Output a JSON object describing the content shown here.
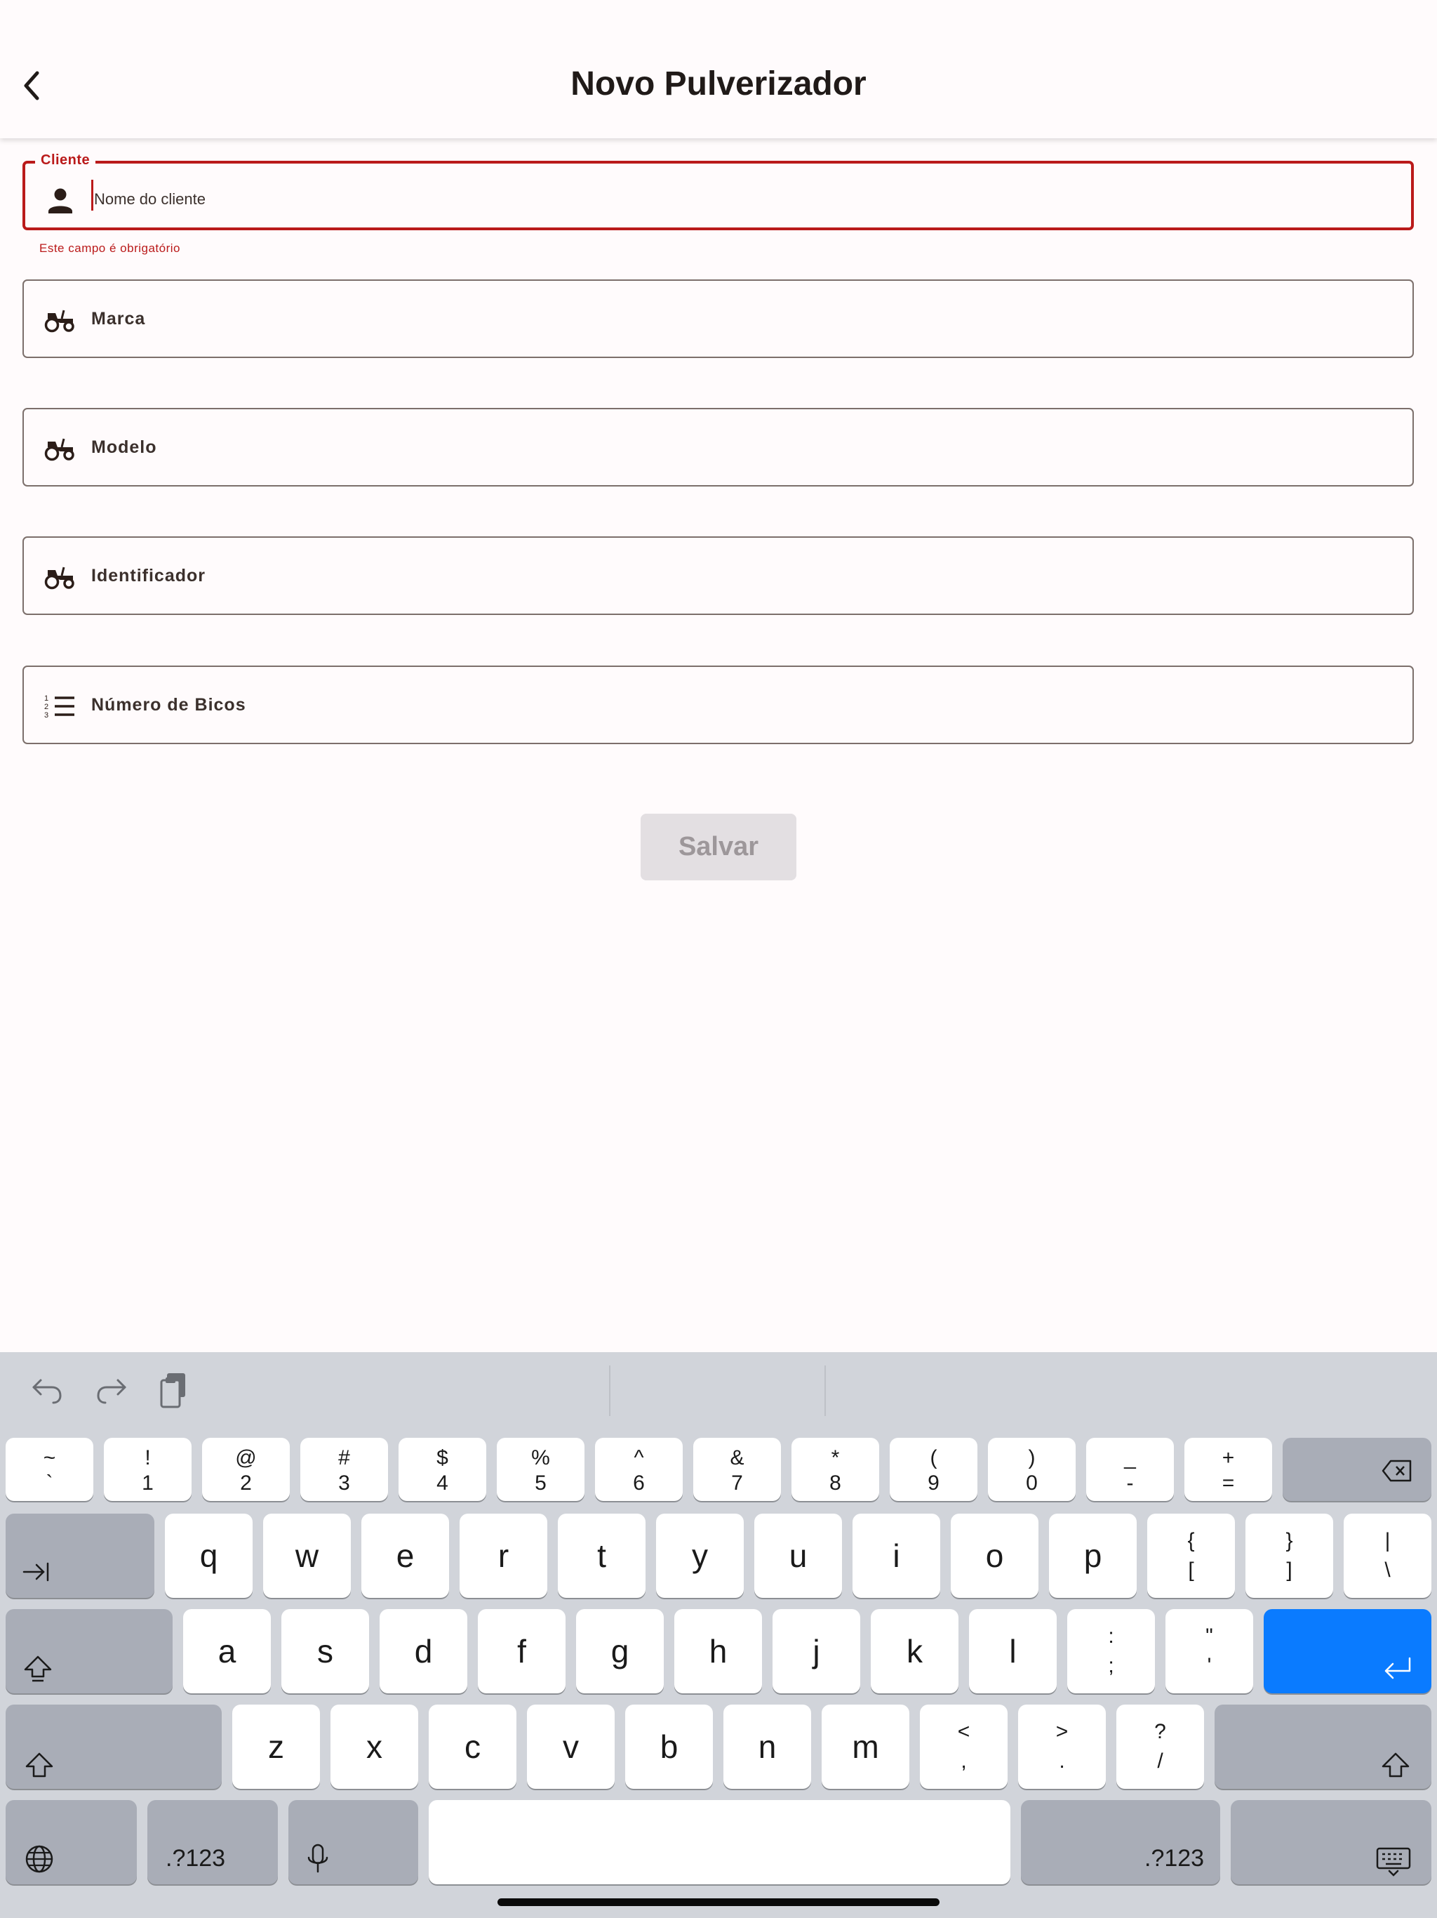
{
  "app_bar": {
    "title": "Novo Pulverizador"
  },
  "form": {
    "cliente": {
      "label": "Cliente",
      "placeholder": "Nome do cliente",
      "value": "",
      "error": "Este campo é obrigatório",
      "icon": "person-icon"
    },
    "marca": {
      "label": "Marca",
      "icon": "tractor-icon"
    },
    "modelo": {
      "label": "Modelo",
      "icon": "tractor-icon"
    },
    "identificador": {
      "label": "Identificador",
      "icon": "tractor-icon"
    },
    "numero_bicos": {
      "label": "Número de Bicos",
      "icon": "numbered-list-icon"
    },
    "save_label": "Salvar"
  },
  "colors": {
    "error": "#ba1a1a",
    "return_key": "#0a7bff",
    "keyboard_bg": "#d1d4da"
  },
  "keyboard": {
    "row_numbers": [
      {
        "top": "~",
        "bottom": "`"
      },
      {
        "top": "!",
        "bottom": "1"
      },
      {
        "top": "@",
        "bottom": "2"
      },
      {
        "top": "#",
        "bottom": "3"
      },
      {
        "top": "$",
        "bottom": "4"
      },
      {
        "top": "%",
        "bottom": "5"
      },
      {
        "top": "^",
        "bottom": "6"
      },
      {
        "top": "&",
        "bottom": "7"
      },
      {
        "top": "*",
        "bottom": "8"
      },
      {
        "top": "(",
        "bottom": "9"
      },
      {
        "top": ")",
        "bottom": "0"
      },
      {
        "top": "_",
        "bottom": "-"
      },
      {
        "top": "+",
        "bottom": "="
      }
    ],
    "row_q": [
      "q",
      "w",
      "e",
      "r",
      "t",
      "y",
      "u",
      "i",
      "o",
      "p"
    ],
    "row_q_extra": [
      {
        "top": "{",
        "bottom": "["
      },
      {
        "top": "}",
        "bottom": "]"
      },
      {
        "top": "|",
        "bottom": "\\"
      }
    ],
    "row_a": [
      "a",
      "s",
      "d",
      "f",
      "g",
      "h",
      "j",
      "k",
      "l"
    ],
    "row_a_extra": [
      {
        "top": ":",
        "bottom": ";"
      },
      {
        "top": "\"",
        "bottom": "'"
      }
    ],
    "row_z": [
      "z",
      "x",
      "c",
      "v",
      "b",
      "n",
      "m"
    ],
    "row_z_extra": [
      {
        "top": "<",
        "bottom": ","
      },
      {
        "top": ">",
        "bottom": "."
      },
      {
        "top": "?",
        "bottom": "/"
      }
    ],
    "numbers_label": ".?123"
  }
}
